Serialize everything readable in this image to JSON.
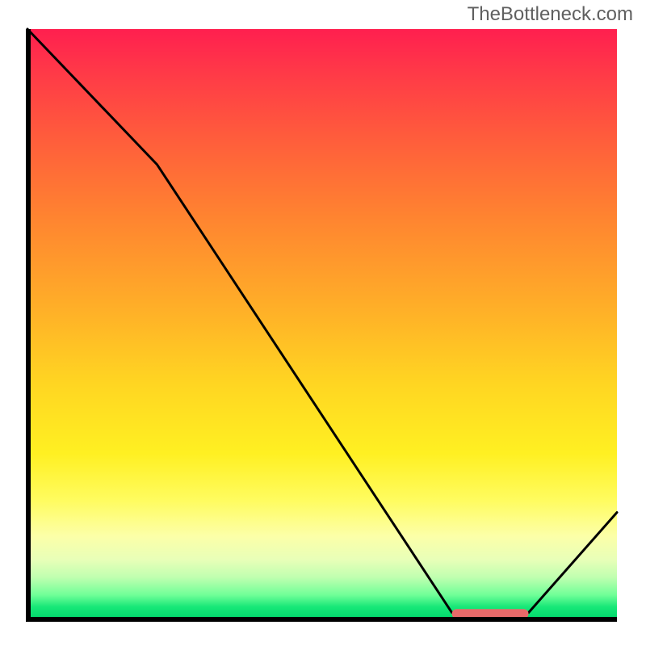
{
  "watermark": "TheBottleneck.com",
  "chart_data": {
    "type": "line",
    "title": "",
    "xlabel": "",
    "ylabel": "",
    "xlim": [
      0,
      100
    ],
    "ylim": [
      0,
      100
    ],
    "series": [
      {
        "name": "bottleneck-curve",
        "x": [
          0,
          22,
          72,
          78,
          85,
          100
        ],
        "y": [
          100,
          77,
          1,
          0,
          1,
          18
        ]
      }
    ],
    "marker_segment": {
      "name": "optimal-range",
      "x_start": 72,
      "x_end": 85,
      "y": 0.8,
      "color": "#e86a6a"
    },
    "background_gradient_stops": [
      {
        "pos": 0,
        "color": "#ff1f4f"
      },
      {
        "pos": 50,
        "color": "#ffc726"
      },
      {
        "pos": 80,
        "color": "#feff70"
      },
      {
        "pos": 100,
        "color": "#00d86c"
      }
    ]
  }
}
